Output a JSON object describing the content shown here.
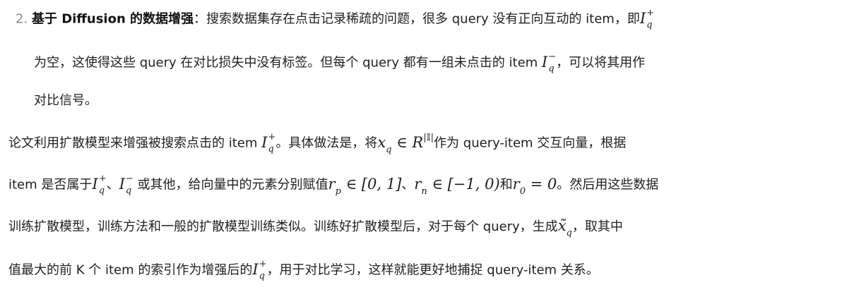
{
  "list_item": {
    "number": "2.",
    "heading": "基于 Diffusion 的数据增强",
    "line1_text": "：搜索数据集存在点击记录稀疏的问题，很多 query 没有正向互动的 item，即",
    "line2_a": "为空，这使得这些 query 在对比损失中没有标签。但每个 query 都有一组未点击的 item ",
    "line2_b": "，可以将其用作",
    "line3": "对比信号。"
  },
  "paragraph": {
    "p1_a": "论文利用扩散模型来增强被搜索点击的 item ",
    "p1_b": "。具体做法是，将",
    "p1_c": "作为 query-item 交互向量，根据",
    "p2_a": "item 是否属于",
    "p2_b": "、",
    "p2_c": " 或其他，给向量中的元素分别赋值",
    "p2_d": "、",
    "p2_e": "和",
    "p2_f": "。然后用这些数据",
    "p3": "训练扩散模型，训练方法和一般的扩散模型训练类似。训练好扩散模型后，对于每个 query，生成",
    "p3_b": "，取其中",
    "p4_a": "值最大的前 K 个 item 的索引作为增强后的",
    "p4_b": "，用于对比学习，这样就能更好地捕捉 query-item 关系。"
  },
  "math": {
    "I": "I",
    "q": "q",
    "plus": "+",
    "minus": "−",
    "x": "x",
    "in": "∈",
    "R": "R",
    "abs_I": "|𝕀|",
    "r": "r",
    "p": "p",
    "n": "n",
    "zero": "0",
    "interval_p": " ∈ [0, 1]",
    "interval_n": " ∈ [−1, 0)",
    "eq_zero": " = 0",
    "tilde_x": "x̃"
  }
}
